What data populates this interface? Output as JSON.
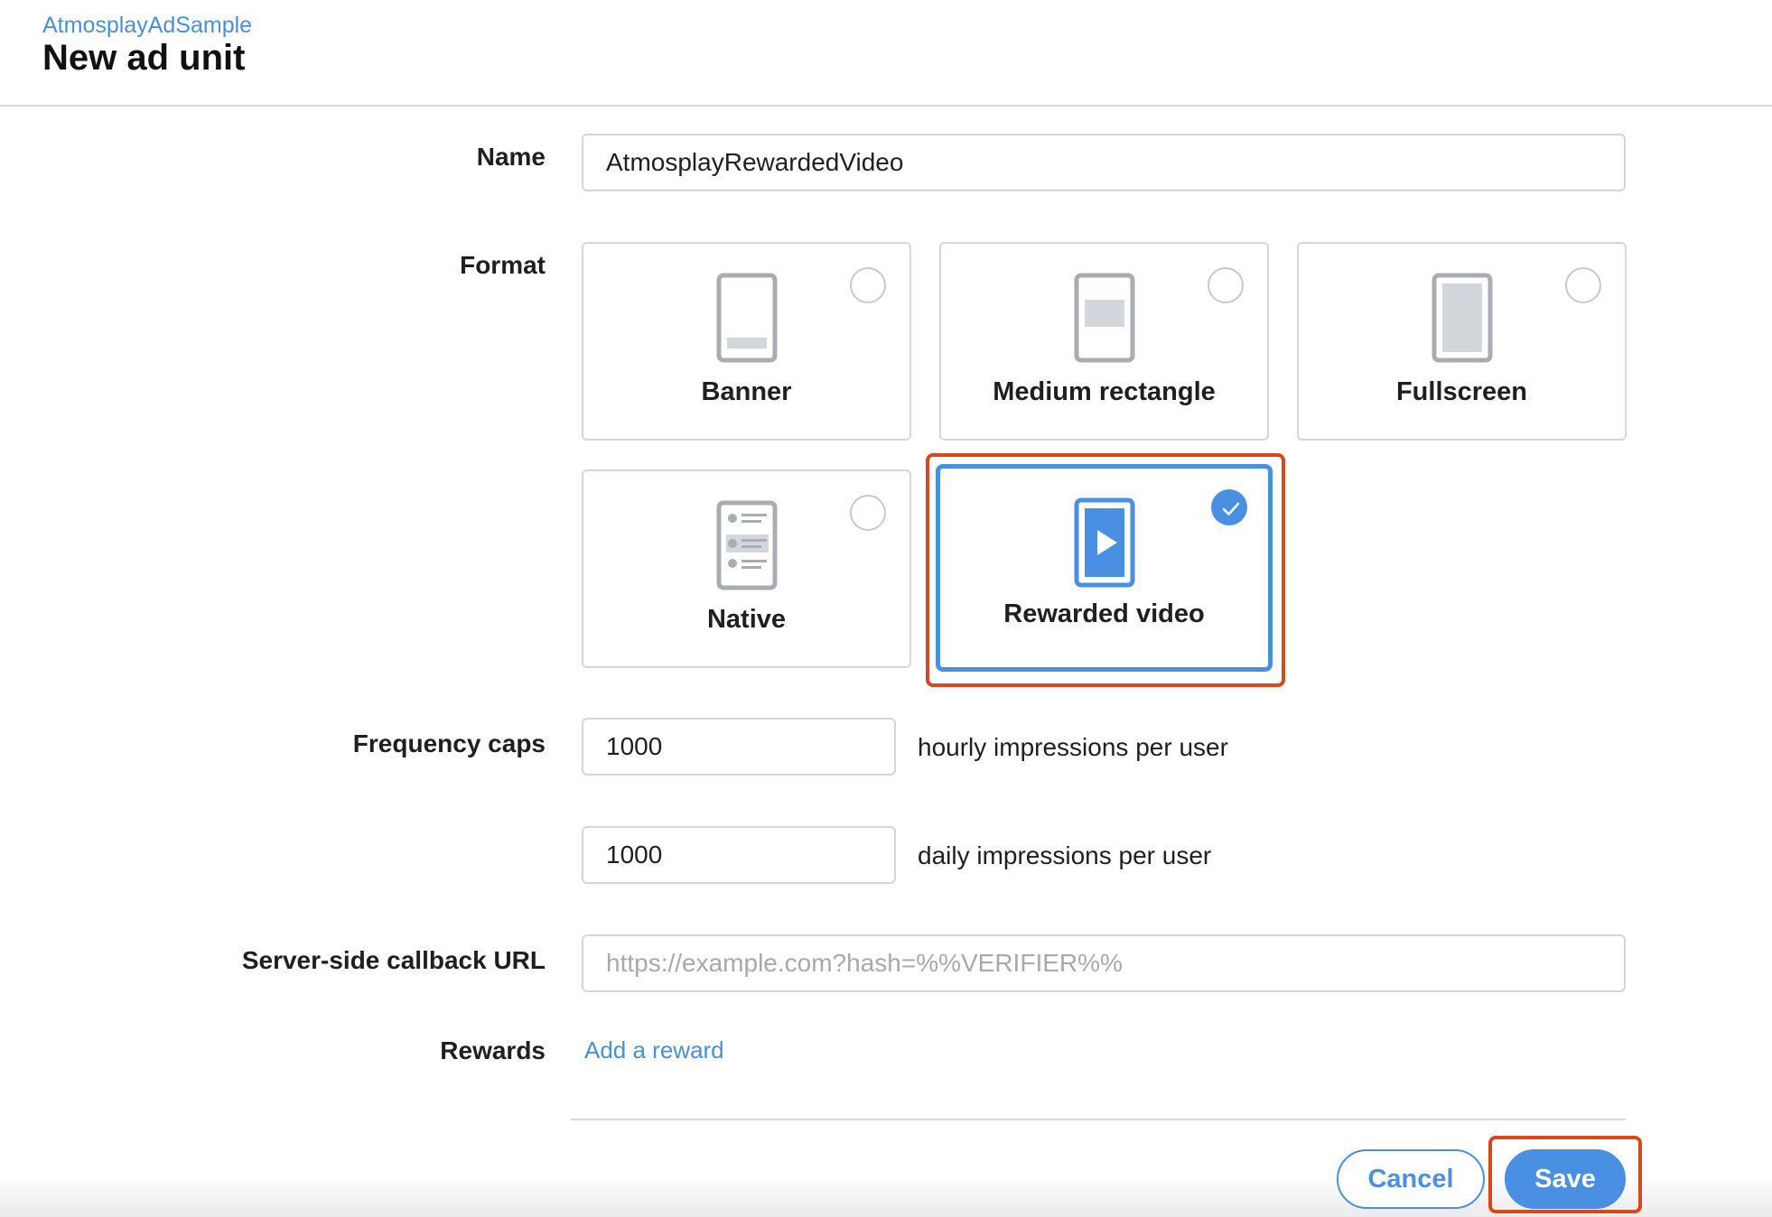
{
  "header": {
    "app_name": "AtmosplayAdSample",
    "title": "New ad unit"
  },
  "form": {
    "name": {
      "label": "Name",
      "value": "AtmosplayRewardedVideo"
    },
    "format": {
      "label": "Format",
      "selected": "Rewarded video",
      "options": [
        {
          "label": "Banner",
          "icon": "banner-phone-icon"
        },
        {
          "label": "Medium rectangle",
          "icon": "medium-rectangle-phone-icon"
        },
        {
          "label": "Fullscreen",
          "icon": "fullscreen-phone-icon"
        },
        {
          "label": "Native",
          "icon": "native-phone-icon"
        },
        {
          "label": "Rewarded video",
          "icon": "rewarded-video-phone-icon"
        }
      ]
    },
    "frequency_caps": {
      "label": "Frequency caps",
      "hourly_value": "1000",
      "hourly_suffix": "hourly impressions per user",
      "daily_value": "1000",
      "daily_suffix": "daily impressions per user"
    },
    "callback_url": {
      "label": "Server-side callback URL",
      "value": "",
      "placeholder": "https://example.com?hash=%%VERIFIER%%"
    },
    "rewards": {
      "label": "Rewards",
      "link": "Add a reward"
    }
  },
  "actions": {
    "cancel_label": "Cancel",
    "save_label": "Save"
  },
  "colors": {
    "accent": "#4a90e2",
    "highlight": "#d9481c",
    "icon_gray": "#a8adb3"
  }
}
